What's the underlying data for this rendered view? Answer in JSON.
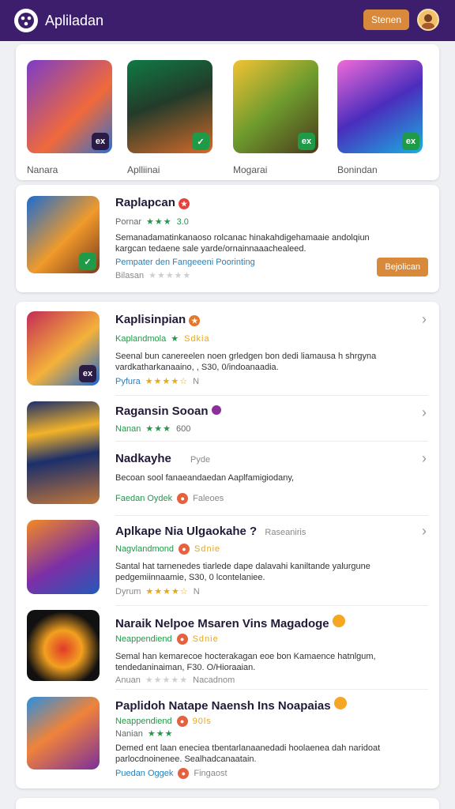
{
  "header": {
    "title": "Apliladan",
    "signin_label": "Stenen"
  },
  "icons": {
    "logo": "app-logo-icon",
    "avatar": "user-avatar"
  },
  "featured": [
    {
      "name": "Nanara",
      "badge": "ex"
    },
    {
      "name": "Aplliinai",
      "badge": "✓"
    },
    {
      "name": "Mogarai",
      "badge": "ex"
    },
    {
      "name": "Bonindan",
      "badge": "ex"
    }
  ],
  "spotlight": {
    "name": "Raplapcan",
    "meta_label": "Pornar",
    "meta_stars": "★★★",
    "meta_extra": "3.0",
    "desc": "Semanadamatinkanaoso rolcanac hinakahdigehamaaie andolqiun kargcan tedaene sale yarde/ornainnaaachealeed.",
    "link": "Pempater den Fangeeeni Poorinting",
    "sub_label": "Bilasan",
    "sub_stars": "★★★★★",
    "button": "Bejolican"
  },
  "list": [
    {
      "name": "Kaplisinpian",
      "category": "Kaplandmola",
      "rating_text": "Sdkia",
      "desc": "Seenal bun canereelen noen grledgen bon dedi liamausa h shrgyna vardkatharkanaaino, , S30, 0/indoanaadia.",
      "sub_label": "Pyfura",
      "stars": "★★★★☆",
      "sub_extra": "N"
    },
    {
      "name": "Ragansin Sooan",
      "category": "Nanan",
      "stars": "★★★",
      "rating_text": "600"
    },
    {
      "name": "Nadkayhe",
      "tag": "Pyde",
      "desc": "Becoan sool fanaeandaedan Aaplfamigiodany,",
      "link": "Faedan Oydek",
      "sub_extra": "Faleoes"
    },
    {
      "name": "Aplkape Nia Ulgaokahe ?",
      "tag": "Raseaniris",
      "category": "Nagvlandmond",
      "rating_text": "Sdnie",
      "desc": "Santal hat tarnenedes tiarlede dape dalavahi kaniltande yalurgune pedgemiinnaamie, S30, 0 lcontelaniee.",
      "sub_label": "Dyrum",
      "stars": "★★★★☆",
      "sub_extra": "N"
    },
    {
      "name": "Naraik Nelpoe Msaren Vins Magadoge",
      "category": "Neappendiend",
      "rating_text": "Sdnie",
      "desc": "Semal han kemarecoe hocterakagan eoe bon Kamaence hatnlgum, tendedaninaiman, F30. O/Hioraaian.",
      "sub_label": "Anuan",
      "stars": "★★★★★",
      "sub_extra": "Nacadnom"
    },
    {
      "name": "Paplidoh Natape Naensh Ins Noapaias",
      "category": "Neappendiend",
      "rating_text": "90ls",
      "sub_category": "Nanian",
      "sub_stars": "★★★",
      "desc": "Demed ent laan eneciea tbentarlanaanedadi hoolaenea dah naridoat parlocdnoinenee. Sealhadcanaatain.",
      "link": "Puedan Oggek",
      "sub_extra": "Fingaost"
    }
  ],
  "colors": {
    "header_bg": "#3d1e6d",
    "accent": "#d9893a",
    "green": "#1f9a47",
    "star": "#e7a81a"
  }
}
